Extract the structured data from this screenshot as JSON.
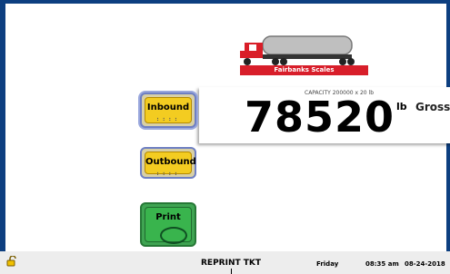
{
  "logo": {
    "brand": "Fairbanks Scales"
  },
  "scale": {
    "capacity_text": "CAPACITY 200000 x 20 lb",
    "weight": "78520",
    "unit": "lb",
    "mode": "Gross"
  },
  "buttons": {
    "inbound": "Inbound",
    "outbound": "Outbound",
    "print": "Print"
  },
  "footer": {
    "reprint": "REPRINT TKT",
    "day": "Friday",
    "time": "08:35 am",
    "date": "08-24-2018"
  }
}
